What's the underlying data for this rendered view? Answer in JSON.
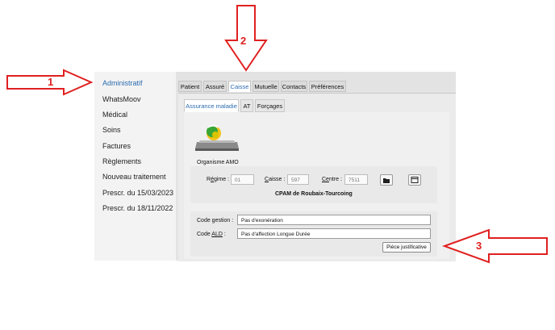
{
  "sidebar": {
    "items": [
      {
        "label": "Administratif",
        "active": true
      },
      {
        "label": "WhatsMoov"
      },
      {
        "label": "Médical"
      },
      {
        "label": "Soins"
      },
      {
        "label": "Factures"
      },
      {
        "label": "Règlements"
      },
      {
        "label": "Nouveau traitement"
      },
      {
        "label": "Prescr. du 15/03/2023"
      },
      {
        "label": "Prescr. du 18/11/2022"
      }
    ]
  },
  "tabs": [
    {
      "label": "Patient"
    },
    {
      "label": "Assuré"
    },
    {
      "label": "Caisse",
      "active": true
    },
    {
      "label": "Mutuelle"
    },
    {
      "label": "Contacts"
    },
    {
      "label": "Préférences"
    }
  ],
  "subtabs": [
    {
      "label": "Assurance maladie",
      "active": true
    },
    {
      "label": "AT"
    },
    {
      "label": "Forçages"
    }
  ],
  "amo": {
    "section_label": "Organisme AMO",
    "regime_label_pre": "R",
    "regime_label_mn": "é",
    "regime_label_post": "gime :",
    "regime_value": "01",
    "caisse_label_pre": "",
    "caisse_label_mn": "C",
    "caisse_label_post": "aisse :",
    "caisse_value": "597",
    "centre_label_pre": "",
    "centre_label_mn": "Ce",
    "centre_label_post": "ntre :",
    "centre_value": "7511",
    "caisse_name": "CPAM de Roubaix-Tourcoing",
    "folder_icon": "folder-icon",
    "window_icon": "window-icon"
  },
  "gestion": {
    "code_gestion_label": "Code gestion :",
    "code_gestion_value": "Pas d'exonération",
    "code_ald_label_pre": "Code ",
    "code_ald_label_mn": "ALD",
    "code_ald_label_post": " :",
    "code_ald_value": "Pas d'affection Longue Durée",
    "piece_button": "Pièce justificative"
  },
  "callouts": [
    {
      "number": "1",
      "color": "#e02020"
    },
    {
      "number": "2",
      "color": "#e02020"
    },
    {
      "number": "3",
      "color": "#e02020"
    }
  ],
  "colors": {
    "accent": "#2b6cb0",
    "callout": "#e02020"
  }
}
